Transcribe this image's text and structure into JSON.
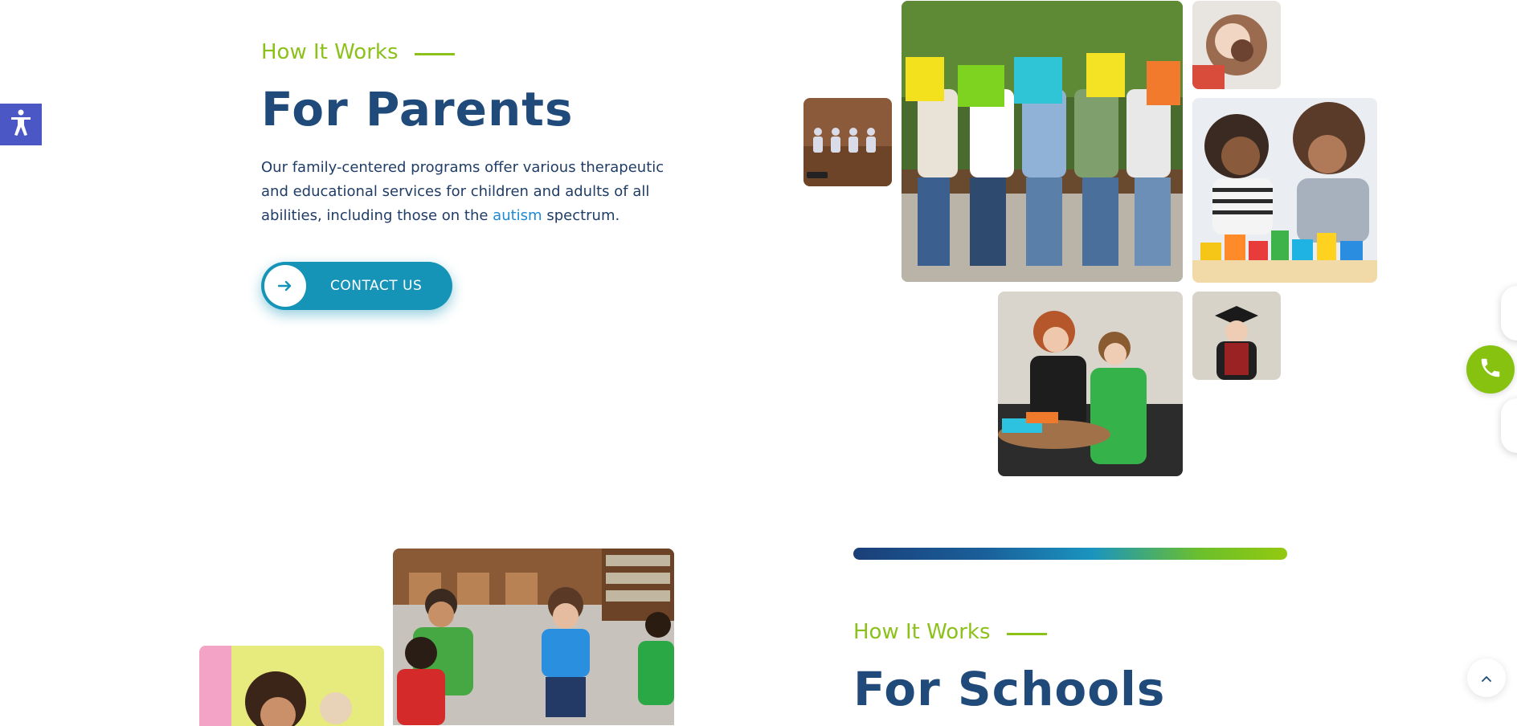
{
  "accessibility": {
    "icon": "accessibility-person-icon"
  },
  "parents": {
    "eyebrow": "How It Works",
    "title": "For Parents",
    "description_before": "Our family-centered programs offer various therapeutic and educational services for children and adults of all abilities, including those on the ",
    "description_link": "autism",
    "description_after": " spectrum.",
    "cta_label": "CONTACT US",
    "cta_icon": "arrow-right-icon"
  },
  "schools": {
    "eyebrow": "How It Works",
    "title": "For Schools"
  },
  "colors": {
    "accent_green": "#8cc11a",
    "navy": "#1f4a7a",
    "teal": "#1694b8",
    "a11y_blue": "#4a57c4"
  },
  "floating": {
    "phone_icon": "phone-icon",
    "scroll_icon": "chevron-up-icon"
  }
}
